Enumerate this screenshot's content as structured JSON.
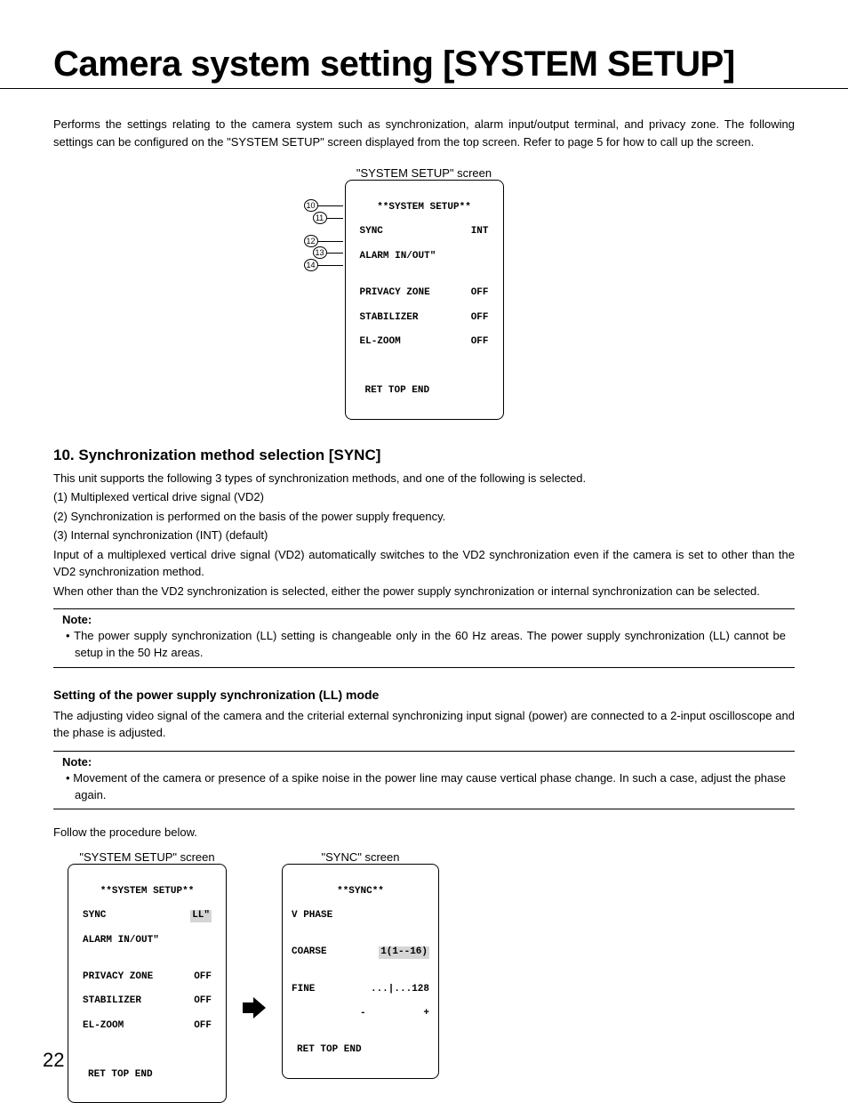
{
  "title_a": "Camera system setting ",
  "title_b": "[SYSTEM SETUP]",
  "intro": "Performs the settings relating to the camera system such as synchronization, alarm input/output terminal, and privacy zone. The following settings can be configured on the \"SYSTEM SETUP\" screen displayed from the top screen. Refer to page 5 for how to call up the screen.",
  "osd1": {
    "caption": "\"SYSTEM SETUP\" screen",
    "title": "**SYSTEM SETUP**",
    "rows": [
      {
        "label": "SYNC",
        "value": "INT"
      },
      {
        "label": "ALARM IN/OUT\"\u0001",
        "value": ""
      },
      {
        "label": "",
        "value": ""
      },
      {
        "label": "PRIVACY ZONE",
        "value": "OFF"
      },
      {
        "label": "STABILIZER",
        "value": "OFF"
      },
      {
        "label": "EL-ZOOM",
        "value": "OFF"
      }
    ],
    "footer": "RET TOP END",
    "callouts": [
      "10",
      "11",
      "12",
      "13",
      "14"
    ]
  },
  "callouts10": "⑩",
  "callouts11": "⑪",
  "callouts12": "⑫",
  "callouts13": "⑬",
  "callouts14": "⑭",
  "sec10_title": "10. Synchronization method selection [SYNC]",
  "sec10_lead": "This unit supports the following 3 types of synchronization methods, and one of the following is selected.",
  "sec10_items": [
    "(1)  Multiplexed vertical drive signal (VD2)",
    "(2)  Synchronization is performed on the basis of the power supply frequency.",
    "(3)  Internal synchronization (INT) (default)"
  ],
  "sec10_p1": "Input of a multiplexed vertical drive signal (VD2) automatically switches to the VD2 synchronization even if the camera is set to other than the VD2 synchronization method.",
  "sec10_p2": "When other than the VD2 synchronization is selected, either the power supply synchronization or internal synchronization can be selected.",
  "note1_label": "Note:",
  "note1_body": "• The power supply synchronization (LL) setting is changeable only in the 60 Hz areas. The power supply synchronization (LL) cannot be setup in the 50 Hz areas.",
  "sub_ll_title": "Setting of the power supply synchronization (LL) mode",
  "sub_ll_p": "The adjusting video signal of the camera and the criterial external synchronizing input signal (power) are connected to a 2-input oscilloscope and the phase is adjusted.",
  "note2_label": "Note:",
  "note2_body": "• Movement of the camera or presence of a spike noise in the power line may cause vertical phase change. In such a case, adjust the phase again.",
  "follow_text": "Follow the procedure below.",
  "osd2": {
    "caption": "\"SYSTEM SETUP\" screen",
    "title": "**SYSTEM SETUP**",
    "rows": [
      {
        "label": "SYNC",
        "value": "LL\"\u0001",
        "hl": true
      },
      {
        "label": "ALARM IN/OUT\"\u0001",
        "value": ""
      },
      {
        "label": "",
        "value": ""
      },
      {
        "label": "PRIVACY ZONE",
        "value": "OFF"
      },
      {
        "label": "STABILIZER",
        "value": "OFF"
      },
      {
        "label": "EL-ZOOM",
        "value": "OFF"
      }
    ],
    "footer": "RET TOP END"
  },
  "osd3": {
    "caption": "\"SYNC\" screen",
    "title": "**SYNC**",
    "rows": [
      {
        "label": "V PHASE",
        "value": ""
      },
      {
        "label": "",
        "value": ""
      },
      {
        "label": "COARSE",
        "value": "1(1--16)",
        "hl": true
      },
      {
        "label": "",
        "value": ""
      },
      {
        "label": "FINE",
        "value": "...|...128"
      },
      {
        "label": "",
        "value_l": "-",
        "value_r": "+"
      }
    ],
    "footer": "RET TOP END"
  },
  "page_number": "22"
}
